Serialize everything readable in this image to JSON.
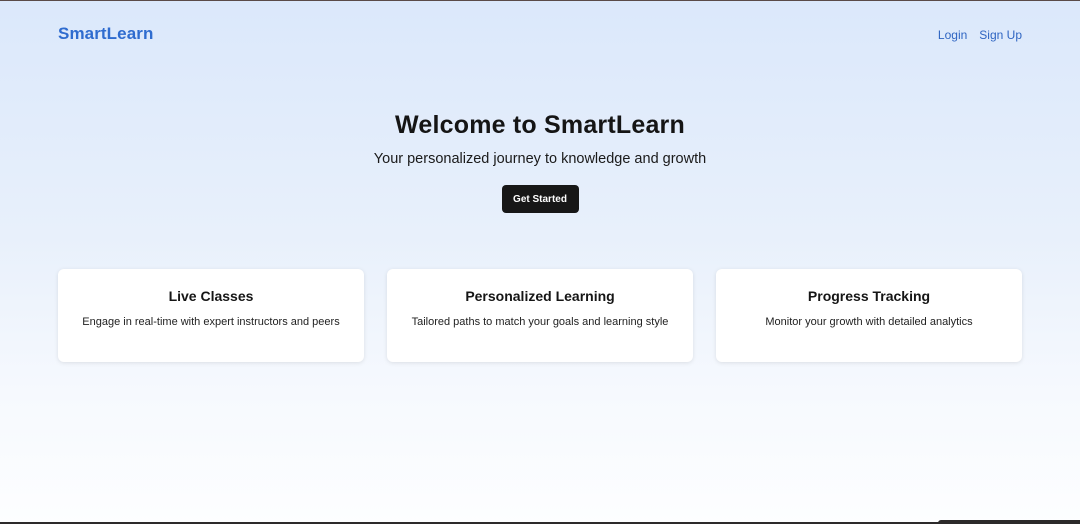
{
  "header": {
    "brand": "SmartLearn",
    "nav": {
      "login": "Login",
      "signup": "Sign Up"
    }
  },
  "hero": {
    "title": "Welcome to SmartLearn",
    "subtitle": "Your personalized journey to knowledge and growth",
    "cta_label": "Get Started"
  },
  "features": [
    {
      "title": "Live Classes",
      "description": "Engage in real-time with expert instructors and peers"
    },
    {
      "title": "Personalized Learning",
      "description": "Tailored paths to match your goals and learning style"
    },
    {
      "title": "Progress Tracking",
      "description": "Monitor your growth with detailed analytics"
    }
  ],
  "colors": {
    "brand": "#2f6ccf",
    "nav_link": "#2f65c2",
    "button_bg": "#171717",
    "background_top": "#dbe8fb",
    "background_bottom": "#fdfeff"
  }
}
